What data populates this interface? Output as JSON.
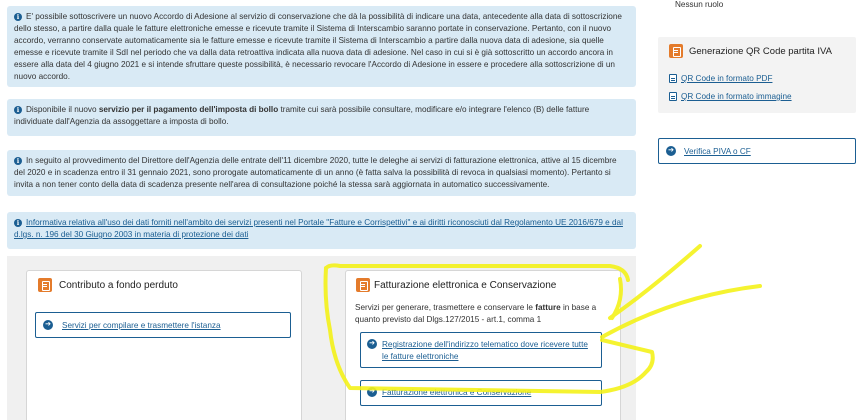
{
  "notices": [
    {
      "text": "E' possibile sottoscrivere un nuovo Accordo di Adesione al servizio di conservazione che dà la possibilità di indicare una data, antecedente alla data di sottoscrizione dello stesso, a partire dalla quale le fatture elettroniche emesse e ricevute tramite il Sistema di Interscambio saranno portate in conservazione. Pertanto, con il nuovo accordo, verranno conservate automaticamente sia le fatture emesse e ricevute tramite il Sistema di Interscambio a partire dalla nuova data di adesione, sia quelle emesse e ricevute tramite il SdI nel periodo che va dalla data retroattiva indicata alla nuova data di adesione. Nel caso in cui si è già sottoscritto un accordo ancora in essere alla data del 4 giugno 2021 e si intende sfruttare queste possibilità, è necessario revocare l'Accordo di Adesione in essere e procedere alla sottoscrizione di un nuovo accordo."
    },
    {
      "pre": "Disponibile il nuovo ",
      "bold": "servizio per il pagamento dell'imposta di bollo",
      "post": " tramite cui sarà possibile consultare, modificare e/o integrare l'elenco (B) delle fatture individuate dall'Agenzia da assoggettare a imposta di bollo."
    },
    {
      "text": "In seguito al provvedimento del Direttore dell'Agenzia delle entrate dell'11 dicembre 2020, tutte le deleghe ai servizi di fatturazione elettronica, attive al 15 dicembre del 2020 e in scadenza entro il 31 gennaio 2021, sono prorogate automaticamente di un anno (è fatta salva la possibilità di revoca in qualsiasi momento). Pertanto si invita a non tener conto della data di scadenza presente nell'area di consultazione poiché la stessa sarà aggiornata in automatico successivamente."
    },
    {
      "link": "Informativa relativa all'uso dei dati forniti nell'ambito dei servizi presenti nel Portale \"Fatture e Corrispettivi\" e ai diritti riconosciuti dal Regolamento UE 2016/679 e dal d.lgs. n. 196 del 30 Giugno 2003 in materia di protezione dei dati"
    }
  ],
  "cards": {
    "contributo": {
      "title": "Contributo a fondo perduto",
      "link": "Servizi per compilare e trasmettere l'istanza"
    },
    "fatturazione": {
      "title": "Fatturazione elettronica e Conservazione",
      "desc_pre": "Servizi per generare, trasmettere e conservare le ",
      "desc_bold": "fatture",
      "desc_post": " in base a quanto previsto dal Dlgs.127/2015 - art.1, comma 1",
      "link1": "Registrazione dell'indirizzo telematico dove ricevere tutte le fatture elettroniche",
      "link2": "Fatturazione elettronica e Conservazione"
    }
  },
  "sidebar": {
    "role_text": "Nessun ruolo",
    "qr": {
      "title": "Generazione QR Code partita IVA",
      "pdf_link": "QR Code in formato PDF",
      "img_link": "QR Code in formato immagine"
    },
    "verifica_link": "Verifica PIVA o CF"
  },
  "colors": {
    "accent_blue": "#1b5e92",
    "notice_bg": "#d9eaf5",
    "icon_orange": "#e47b2b",
    "highlighter": "#f4f21a"
  }
}
